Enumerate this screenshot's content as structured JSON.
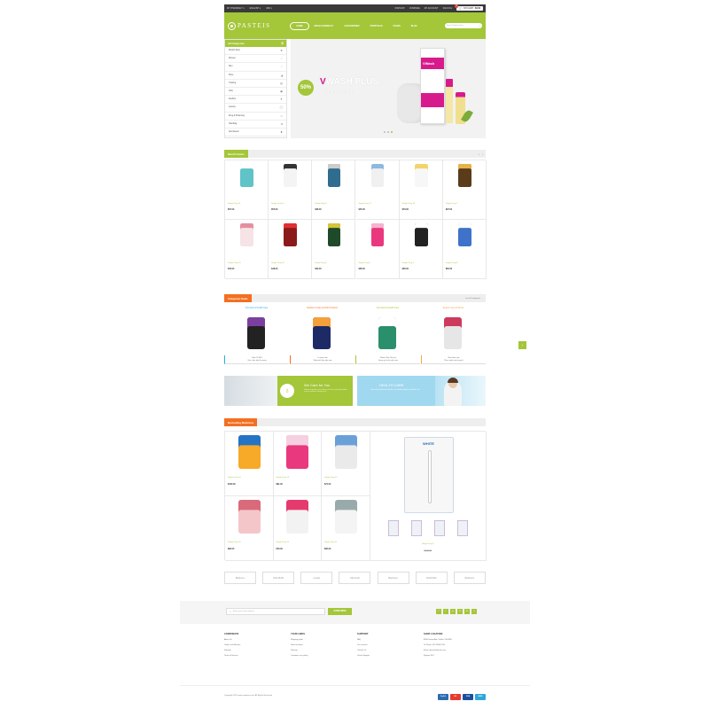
{
  "topbar": {
    "left": [
      "MY PHARMACY ▾",
      "ENGLISH ▾",
      "USD ▾"
    ],
    "right": [
      "WISHLIST",
      "COMPARE",
      "MY ACCOUNT",
      "SIGN IN ▾"
    ],
    "cart_label": "MY CART",
    "cart_total": "$0.00",
    "cart_count": "0"
  },
  "header": {
    "logo": "PASTEIS",
    "nav": [
      "HOME",
      "DRUG PHARMACY",
      "ACCESSORIES",
      "PORTFOLIO",
      "PAGES",
      "BLOG"
    ],
    "search_placeholder": "Search Product here..."
  },
  "categories": {
    "title": "All Categories",
    "items": [
      {
        "label": "World's Best",
        "icon": "gift-icon"
      },
      {
        "label": "Women",
        "icon": "female-icon"
      },
      {
        "label": "Men",
        "icon": "male-icon"
      },
      {
        "label": "Shoe",
        "icon": "shoe-icon"
      },
      {
        "label": "Training",
        "icon": "dumbbell-icon"
      },
      {
        "label": "Gifts",
        "icon": "gift-box-icon"
      },
      {
        "label": "Fashion",
        "icon": "shirt-icon"
      },
      {
        "label": "Jewelry",
        "icon": "ring-icon"
      },
      {
        "label": "Drug & Pharmacy",
        "icon": "pill-icon"
      },
      {
        "label": "Handbag",
        "icon": "bag-icon"
      },
      {
        "label": "Sportswear",
        "icon": "trophy-icon"
      }
    ]
  },
  "banner": {
    "badge": "50%",
    "title_v": "V",
    "title_rest": "WASH PLUS",
    "subtitle": "SALE FOR CASH",
    "box_label": "VWash",
    "slider_progress": 0.5
  },
  "new_products": {
    "title": "New Products",
    "items": [
      {
        "name": "Single Drug 21",
        "price": "$57.00"
      },
      {
        "name": "Single Drug 10",
        "price": "$55.00"
      },
      {
        "name": "Single Drug 9",
        "price": "$38.00"
      },
      {
        "name": "Single Drug 17",
        "price": "$45.00"
      },
      {
        "name": "Single Drug 16",
        "price": "$79.00"
      },
      {
        "name": "Single Drug 1",
        "price": "$97.00"
      },
      {
        "name": "Single Drug 14",
        "price": "$79.00"
      },
      {
        "name": "Single Drug 20",
        "price": "$48.00"
      },
      {
        "name": "Single Drug 6",
        "price": "$59.00"
      },
      {
        "name": "Single Drug 5",
        "price": "$58.00"
      },
      {
        "name": "Single Drug 4",
        "price": "$65.00"
      },
      {
        "name": "Single Drug 8",
        "price": "$60.00"
      }
    ]
  },
  "deals": {
    "title": "Categories Deals",
    "view_all": "see all categories →",
    "cols": [
      {
        "title": "First Aids & Health Care",
        "color": "#2aa9e0",
        "line1": "Sale Off 30%",
        "line2": "Get a free ride & money"
      },
      {
        "title": "Nutrition Foods & Drink Products",
        "color": "#f36f21",
        "line1": "In store now",
        "line2": "Shop with this sale now"
      },
      {
        "title": "First Aids & Health Care",
        "color": "#a4c639",
        "line1": "Winter Sale 10 price",
        "line2": "Hurry up to this sale now"
      },
      {
        "title": "Beauty Care Products",
        "color": "#f3a64b",
        "line1": "New from now",
        "line2": "Place order now to get it"
      }
    ]
  },
  "promos": {
    "left_title": "We Care for You",
    "left_text": "Dolorem molestiae quas dolores sint elit corrupti quos dolores et quas molestias excepturi sint",
    "right_title": "HEALTH CARE",
    "right_text": "We provide professional health care including Digital and Health Care"
  },
  "bestselling": {
    "title": "Bestselling Medicines",
    "items": [
      {
        "name": "Single Drug 13",
        "price": "$100.00"
      },
      {
        "name": "Single Drug 18",
        "price": "$91.00"
      },
      {
        "name": "Single Drug 12",
        "price": "$71.00"
      },
      {
        "name": "Single Drug 19",
        "price": "$82.00"
      },
      {
        "name": "Single Drug 15",
        "price": "$76.00"
      },
      {
        "name": "Single Drug 11",
        "price": "$95.00"
      }
    ],
    "featured": {
      "name": "Single Drug 8",
      "price": "$100.00",
      "box_label": "WHITE"
    }
  },
  "brands": [
    "Bedroom",
    "DOLPHIN",
    "envato",
    "Microsoft",
    "Bedroom",
    "DOLPHIN",
    "Bedroom"
  ],
  "newsletter": {
    "placeholder": "Enter your email address",
    "button": "SUBSCRIBE",
    "social": [
      "f",
      "t",
      "g",
      "p",
      "in",
      "y"
    ]
  },
  "footer": {
    "cols": [
      {
        "title": "CORPORATE",
        "links": [
          "About Us",
          "Orders and Returns",
          "Sitemap",
          "Terms of Service"
        ]
      },
      {
        "title": "YOUR LINKS",
        "links": [
          "Shipping guide",
          "Store locations",
          "Sitemap",
          "Customer care policy"
        ]
      },
      {
        "title": "SUPPORT",
        "links": [
          "FAQ",
          "Our services",
          "Contact Us",
          "Online Support"
        ]
      },
      {
        "title": "SHOP LOCATION",
        "links": [
          "8036 Lemon Ave, Dallas, CA 9380",
          "To Phone: 020 20409 234",
          "Email: demo@domain.com",
          "Support 24/7"
        ]
      }
    ],
    "copyright": "Copyright 2015 www.codazon.com. All Rights Reserved",
    "payments": [
      "PayPal",
      "MC",
      "VISA",
      "AMEX"
    ]
  },
  "colors": {
    "accent": "#a4c639",
    "orange": "#f36f21",
    "dark": "#3a3a3a"
  }
}
